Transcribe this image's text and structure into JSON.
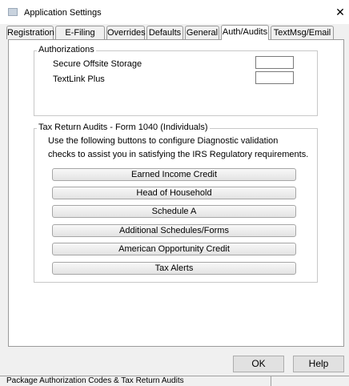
{
  "window": {
    "title": "Application Settings"
  },
  "tabs": [
    {
      "label": "Registration"
    },
    {
      "label": "E-Filing"
    },
    {
      "label": "Overrides"
    },
    {
      "label": "Defaults"
    },
    {
      "label": "General"
    },
    {
      "label": "Auth/Audits"
    },
    {
      "label": "TextMsg/Email"
    }
  ],
  "authorizations": {
    "legend": "Authorizations",
    "items": [
      {
        "label": "Secure Offsite Storage",
        "value": ""
      },
      {
        "label": "TextLink Plus",
        "value": ""
      }
    ]
  },
  "audits": {
    "legend": "Tax Return Audits - Form 1040 (Individuals)",
    "description_line1": "Use the following buttons to configure Diagnostic validation",
    "description_line2": "checks to assist you in satisfying the IRS Regulatory requirements.",
    "buttons": [
      "Earned Income Credit",
      "Head of Household",
      "Schedule A",
      "Additional Schedules/Forms",
      "American Opportunity Credit",
      "Tax Alerts"
    ]
  },
  "dialog": {
    "ok_label": "OK",
    "help_label": "Help"
  },
  "status": {
    "text": "Package Authorization Codes & Tax Return Audits"
  }
}
